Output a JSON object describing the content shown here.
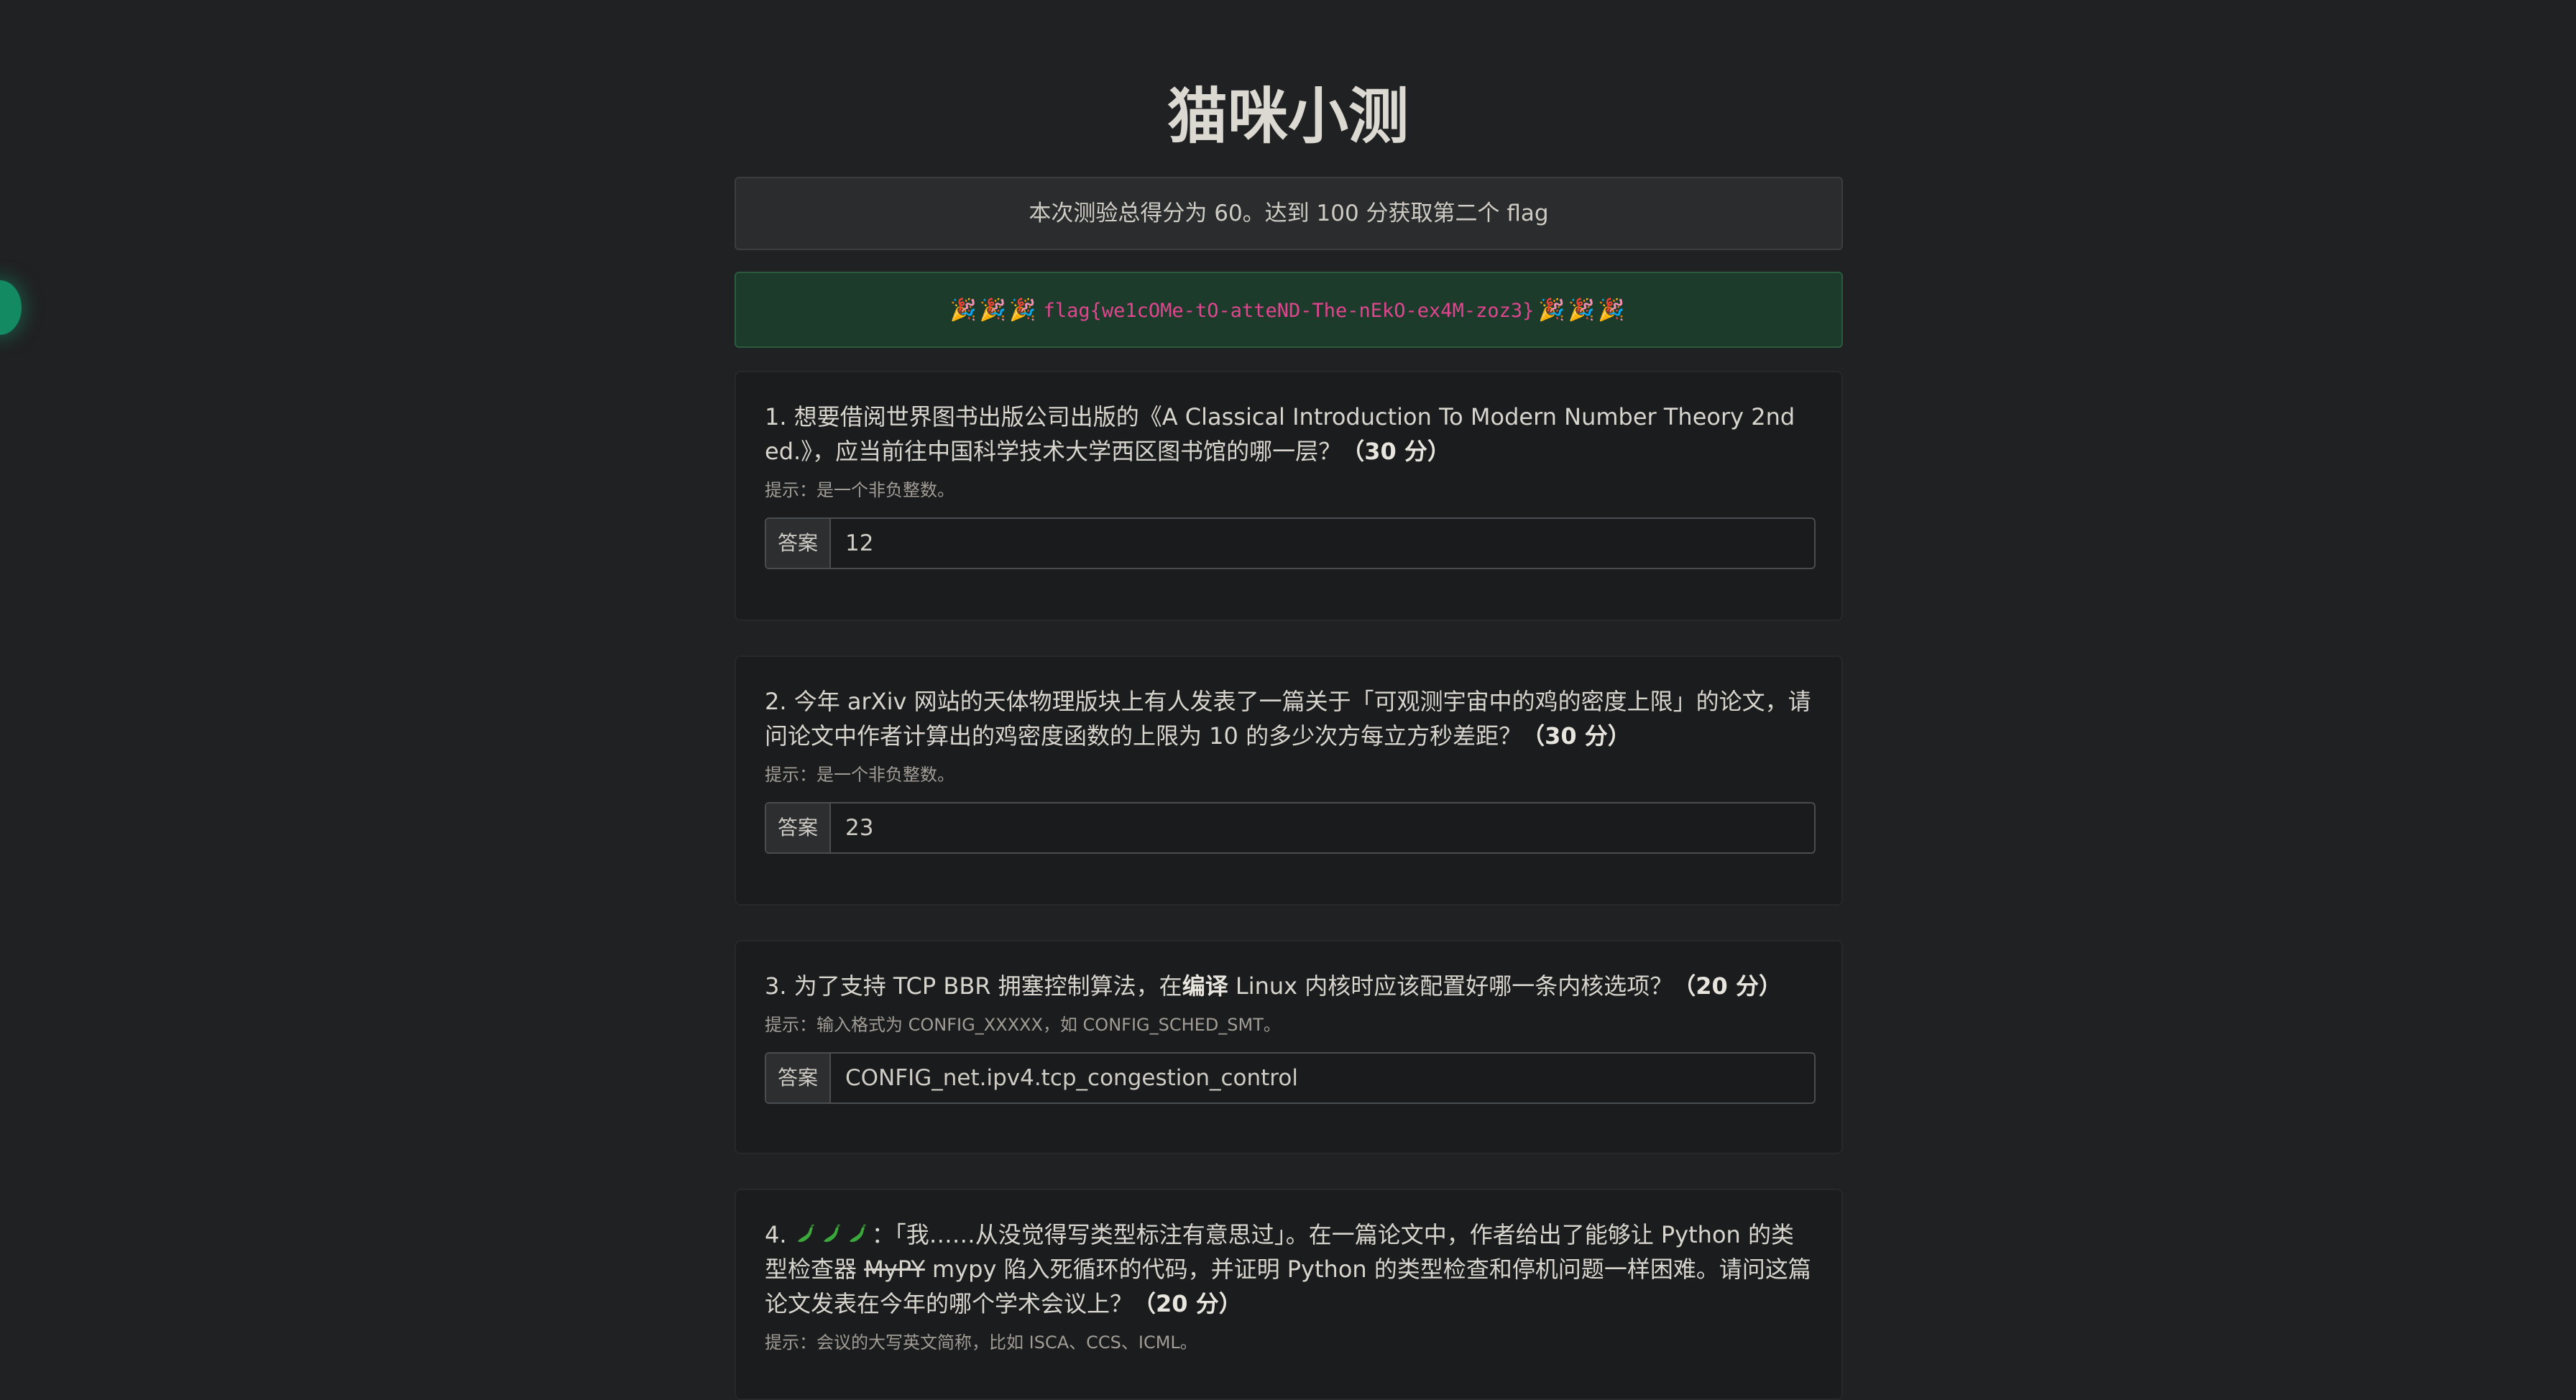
{
  "page": {
    "title": "猫咪小测",
    "score_text": "本次测验总得分为 60。达到 100 分获取第二个 flag",
    "flag": "flag{we1cOMe-tO-atteND-The-nEkO-ex4M-zoz3}",
    "party_icon": "🎉",
    "answer_label": "答案"
  },
  "questions": [
    {
      "text": "1. 想要借阅世界图书出版公司出版的《A Classical Introduction To Modern Number Theory 2nd ed.》，应当前往中国科学技术大学西区图书馆的哪一层？",
      "points": "（30 分）",
      "hint": "提示：是一个非负整数。",
      "answer": "12"
    },
    {
      "text": "2. 今年 arXiv 网站的天体物理版块上有人发表了一篇关于「可观测宇宙中的鸡的密度上限」的论文，请问论文中作者计算出的鸡密度函数的上限为 10 的多少次方每立方秒差距？",
      "points": "（30 分）",
      "hint": "提示：是一个非负整数。",
      "answer": "23"
    },
    {
      "text_before": "3. 为了支持 TCP BBR 拥塞控制算法，在",
      "text_bold": "编译",
      "text_after": " Linux 内核时应该配置好哪一条内核选项？",
      "points": "（20 分）",
      "hint": "提示：输入格式为 CONFIG_XXXXX，如 CONFIG_SCHED_SMT。",
      "answer": "CONFIG_net.ipv4.tcp_congestion_control"
    },
    {
      "number": "4. ",
      "text_a": "：「我……从没觉得写类型标注有意思过」。在一篇论文中，作者给出了能够让 Python 的类型检查器 ",
      "text_strike": "MyPY",
      "text_b": " mypy 陷入死循环的代码，并证明 Python 的类型检查和停机问题一样困难。请问这篇论文发表在今年的哪个学术会议上？",
      "points": "（20 分）",
      "hint": "提示：会议的大写英文简称，比如 ISCA、CCS、ICML。"
    }
  ],
  "colors": {
    "background": "#202122",
    "flag_pink": "#e0468f",
    "flag_bg": "#1d3b2a"
  }
}
